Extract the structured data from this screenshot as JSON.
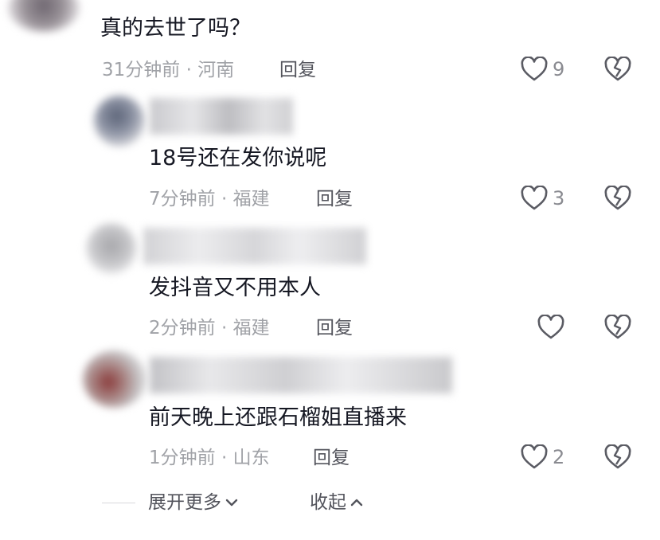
{
  "comments": [
    {
      "text": "真的去世了吗？",
      "meta": "31分钟前 · 河南",
      "reply": "回复",
      "likes": "9"
    },
    {
      "text": "18号还在发你说呢",
      "meta": "7分钟前 · 福建",
      "reply": "回复",
      "likes": "3"
    },
    {
      "text": "发抖音又不用本人",
      "meta": "2分钟前 · 福建",
      "reply": "回复",
      "likes": ""
    },
    {
      "text": "前天晚上还跟石榴姐直播来",
      "meta": "1分钟前 · 山东",
      "reply": "回复",
      "likes": "2"
    }
  ],
  "footer": {
    "expand_label": "展开更多",
    "collapse_label": "收起"
  },
  "colors": {
    "text": "#161823",
    "meta": "#a0a2a7",
    "icon": "#5a5b63"
  },
  "icons": {
    "like": "heart-outline-icon",
    "dislike": "broken-heart-icon"
  }
}
